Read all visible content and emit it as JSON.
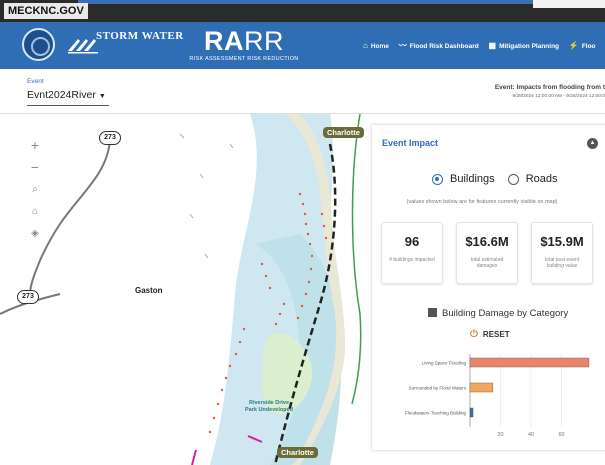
{
  "topbar": {
    "site": "MECKNC.GOV"
  },
  "header": {
    "storm_logo_text": "STORM WATER",
    "app_name_bold": "RA",
    "app_name_light": "RR",
    "app_subtitle": "RISK ASSESSMENT RISK REDUCTION",
    "nav": [
      {
        "label": "Home",
        "icon": "home-icon"
      },
      {
        "label": "Flood Risk Dashboard",
        "icon": "trend-icon"
      },
      {
        "label": "Mitigation Planning",
        "icon": "building-icon"
      },
      {
        "label": "Floo",
        "icon": "lightning-icon"
      }
    ]
  },
  "event": {
    "label": "Event",
    "selected": "Evnt2024River",
    "title": "Event: Impacts from flooding from t",
    "dates": "9/28/2024 12:00:00 AM - 9/28/2024 12:00:0"
  },
  "map": {
    "labels": {
      "gaston": "Gaston",
      "route_a": "273",
      "route_b": "273",
      "city_top": "Charlotte",
      "city_bottom": "Charlotte",
      "park": "Riverside Drive Park Undeveloped"
    },
    "controls": [
      "zoom-in",
      "zoom-out",
      "search",
      "home",
      "layers"
    ]
  },
  "panel": {
    "title": "Event Impact",
    "options": [
      "Buildings",
      "Roads"
    ],
    "selected_option": "Buildings",
    "note": "(values shown below are for features currently visible on map)",
    "stats": [
      {
        "value": "96",
        "label": "# buildings impacted"
      },
      {
        "value": "$16.6M",
        "label": "total estimated damages"
      },
      {
        "value": "$15.9M",
        "label": "total post-event building value"
      }
    ],
    "chart_title": "Building Damage by Category",
    "reset_label": "RESET"
  },
  "chart_data": {
    "type": "bar",
    "orientation": "horizontal",
    "categories": [
      "Living Space Flooding",
      "Surrounded by Flood Waters",
      "Floodwaters Touching Building"
    ],
    "values": [
      78,
      15,
      2
    ],
    "colors": [
      "#e9866a",
      "#f0a85c",
      "#3a6fb3"
    ],
    "x_ticks": [
      20,
      40,
      60
    ],
    "xlim": [
      0,
      80
    ]
  }
}
